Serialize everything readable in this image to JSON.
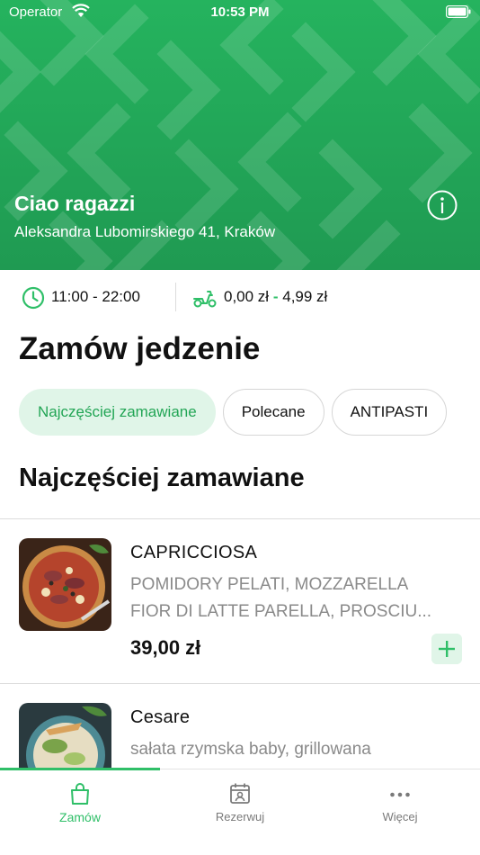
{
  "status_bar": {
    "carrier": "Operator",
    "time": "10:53 PM"
  },
  "restaurant": {
    "name": "Ciao ragazzi",
    "address": "Aleksandra Lubomirskiego 41, Kraków",
    "hours": "11:00 - 22:00",
    "delivery_fee_min": "0,00 zł",
    "delivery_fee_sep": "-",
    "delivery_fee_max": "4,99 zł"
  },
  "page_title": "Zamów jedzenie",
  "categories": [
    "Najczęściej zamawiane",
    "Polecane",
    "ANTIPASTI"
  ],
  "selected_category": "Najczęściej zamawiane",
  "section": {
    "title": "Najczęściej zamawiane",
    "items": [
      {
        "name": "CAPRICCIOSA",
        "description_line1": "POMIDORY PELATI, MOZZARELLA",
        "description_line2": "FIOR DI LATTE PARELLA, PROSCIU...",
        "price": "39,00 zł"
      },
      {
        "name": "Cesare",
        "description_line1": "sałata rzymska baby, grillowana"
      }
    ]
  },
  "tabs": [
    {
      "label": "Zamów",
      "icon": "shopping-bag-icon",
      "active": true
    },
    {
      "label": "Rezerwuj",
      "icon": "calendar-person-icon",
      "active": false
    },
    {
      "label": "Więcej",
      "icon": "more-dots-icon",
      "active": false
    }
  ],
  "colors": {
    "accent": "#2fbf68",
    "hero": "#22a858",
    "chip_active_bg": "#e0f5e8"
  }
}
